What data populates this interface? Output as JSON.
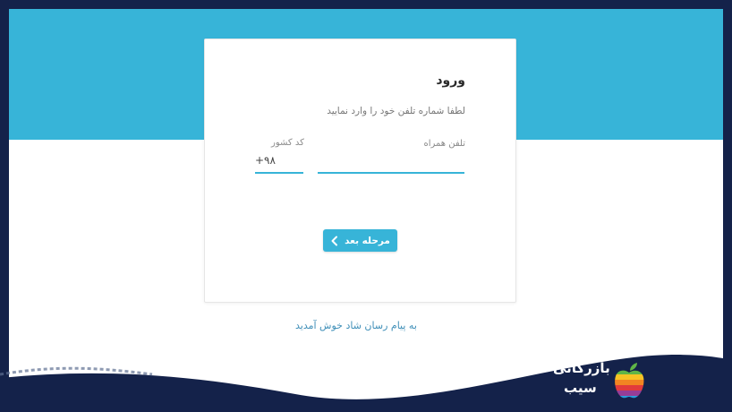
{
  "login": {
    "title": "ورود",
    "subtitle": "لطفا شماره تلفن خود را وارد نمایید",
    "phone_label": "تلفن همراه",
    "phone_value": "",
    "country_code_label": "کد کشور",
    "country_code_value": "+۹۸",
    "next_button_label": "مرحله بعد"
  },
  "footer": {
    "welcome_text": "به پیام رسان شاد خوش آمدید"
  },
  "branding": {
    "logo_line1": "بازرگانی",
    "logo_line2": "سیب"
  },
  "colors": {
    "accent": "#37b4d8",
    "page_background": "#14224a"
  },
  "icons": {
    "next": "chevron-left-icon",
    "logo": "apple-logo"
  }
}
